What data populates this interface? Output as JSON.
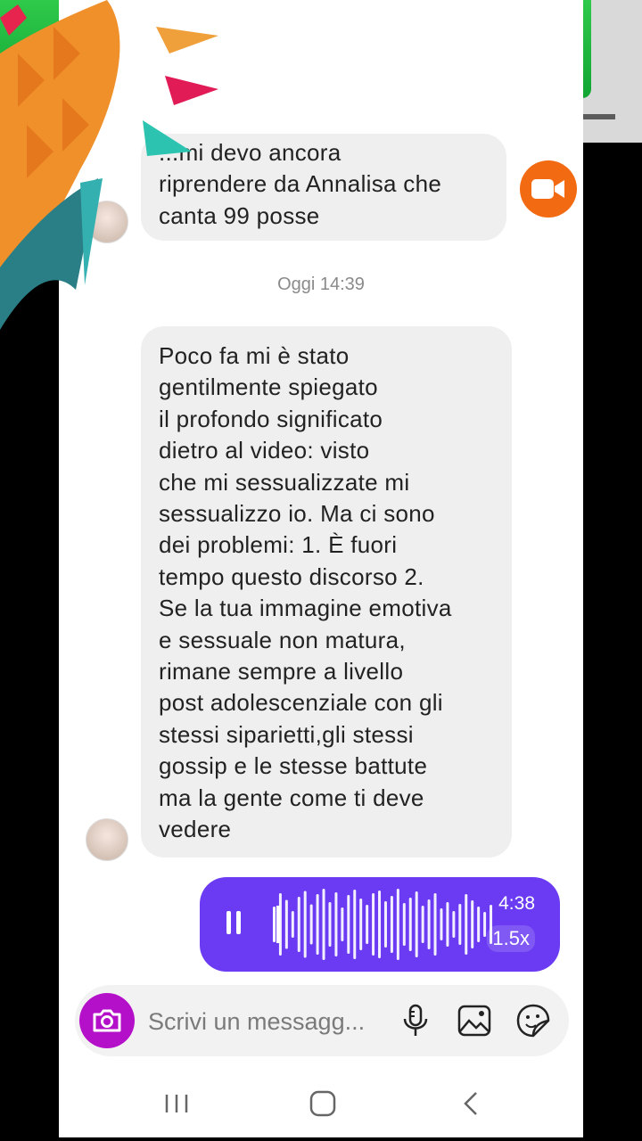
{
  "chat": {
    "partial_message": "...mi devo ancora\nriprendere da Annalisa che\ncanta 99 posse",
    "timestamp": "Oggi 14:39",
    "long_message": "Poco fa mi è stato\ngentilmente spiegato\nil profondo significato\ndietro al video: visto\nche mi sessualizzate mi\nsessualizzo io. Ma ci sono\ndei problemi: 1. È fuori\ntempo questo discorso 2.\nSe la tua immagine emotiva\ne sessuale non matura,\nrimane sempre a livello\npost adolescenziale con gli\nstessi siparietti,gli stessi\ngossip e le stesse battute\nma la gente come ti deve\nvedere"
  },
  "voice_message": {
    "duration": "4:38",
    "speed": "1.5x",
    "progress": 0.04,
    "state": "playing"
  },
  "composer": {
    "placeholder": "Scrivi un messagg..."
  },
  "icons": {
    "video_call": "video-camera-icon",
    "camera": "camera-icon",
    "mic": "microphone-icon",
    "gallery": "image-icon",
    "sticker": "sticker-icon",
    "pause": "pause-icon",
    "nav_recent": "recent-apps-icon",
    "nav_home": "home-icon",
    "nav_back": "back-icon"
  },
  "colors": {
    "voice_bubble": "#6a3bf2",
    "camera_button": "#b40fc9",
    "video_button": "#f26a11",
    "banner_green": "#1fb53d"
  }
}
